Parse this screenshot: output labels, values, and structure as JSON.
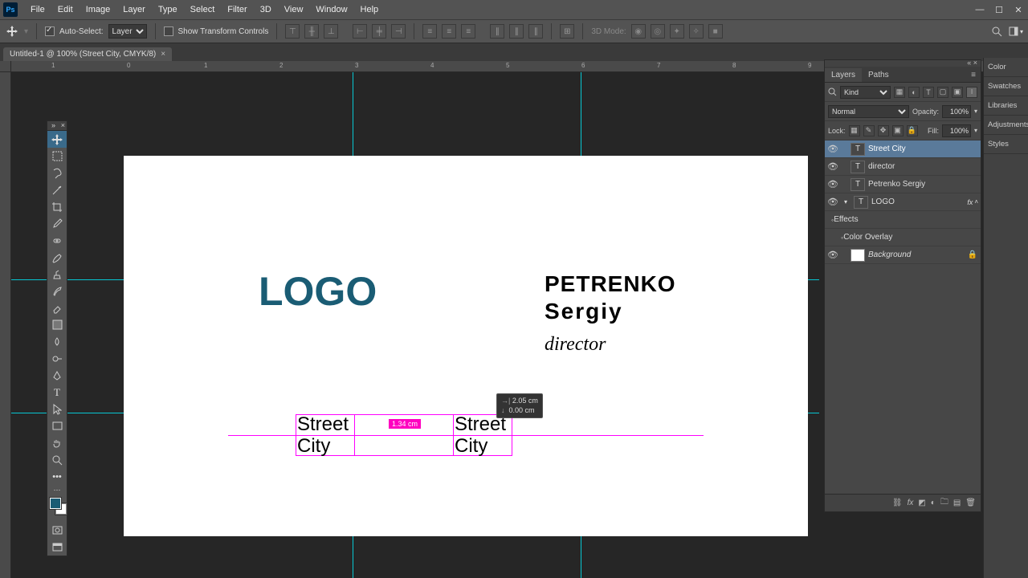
{
  "menu": {
    "items": [
      "File",
      "Edit",
      "Image",
      "Layer",
      "Type",
      "Select",
      "Filter",
      "3D",
      "View",
      "Window",
      "Help"
    ],
    "app_abbrev": "Ps"
  },
  "options": {
    "auto_select_label": "Auto-Select:",
    "auto_select_target": "Layer",
    "show_transform_label": "Show Transform Controls",
    "three_d_label": "3D Mode:"
  },
  "document": {
    "tab_title": "Untitled-1 @ 100% (Street City, CMYK/8)"
  },
  "ruler_marks": [
    "1",
    "0",
    "1",
    "2",
    "3",
    "4",
    "5",
    "6",
    "7",
    "8",
    "9"
  ],
  "artwork": {
    "logo": "LOGO",
    "name1": "PETRENKO",
    "name2": "Sergiy",
    "role": "director",
    "street1": "Street",
    "city1": "City",
    "street2": "Street",
    "city2": "City",
    "dist_label": "1.34 cm",
    "info1": "2.05 cm",
    "info2": "0.00 cm"
  },
  "right_tabs": [
    "Color",
    "Swatches",
    "Libraries",
    "Adjustments",
    "Styles"
  ],
  "layers_panel": {
    "tabs": [
      "Layers",
      "Paths"
    ],
    "kind_placeholder": "Kind",
    "blend": "Normal",
    "opacity_label": "Opacity:",
    "opacity": "100%",
    "lock_label": "Lock:",
    "fill_label": "Fill:",
    "fill": "100%",
    "items": [
      {
        "name": "Street City",
        "type": "T",
        "selected": true
      },
      {
        "name": "director",
        "type": "T"
      },
      {
        "name": "Petrenko Sergiy",
        "type": "T"
      },
      {
        "name": "LOGO",
        "type": "T",
        "fx": true,
        "effects": [
          "Effects",
          "Color Overlay"
        ]
      },
      {
        "name": "Background",
        "type": "bg",
        "locked": true
      }
    ]
  },
  "tooltips": {}
}
